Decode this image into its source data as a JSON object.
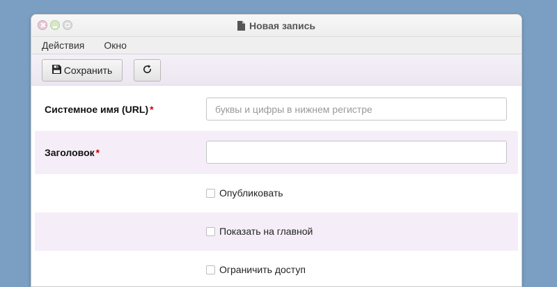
{
  "window": {
    "title": "Новая запись",
    "title_icon": "document-icon"
  },
  "menu": {
    "items": [
      "Действия",
      "Окно"
    ]
  },
  "toolbar": {
    "save_label": "Сохранить",
    "save_icon": "floppy-disk-icon",
    "refresh_icon": "refresh-icon"
  },
  "form": {
    "system_name": {
      "label": "Системное имя (URL)",
      "required_mark": "*",
      "value": "",
      "placeholder": "буквы и цифры в нижнем регистре"
    },
    "heading": {
      "label": "Заголовок",
      "required_mark": "*",
      "value": "",
      "placeholder": ""
    },
    "publish": {
      "label": "Опубликовать",
      "checked": false
    },
    "show_on_main": {
      "label": "Показать на главной",
      "checked": false
    },
    "restrict_access": {
      "label": "Ограничить доступ",
      "checked": false
    }
  },
  "colors": {
    "background": "#7a9fc2",
    "stripe": "#f5eef8",
    "required": "#cc0000"
  }
}
